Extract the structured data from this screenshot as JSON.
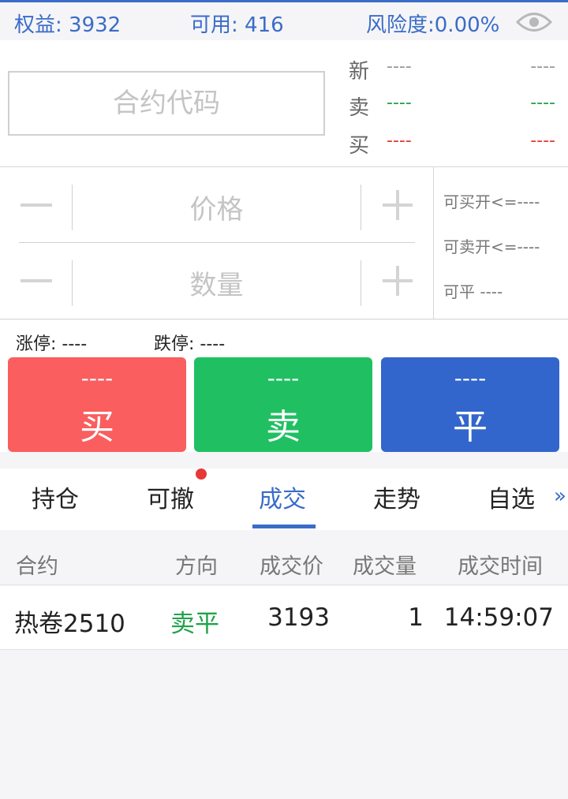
{
  "header": {
    "equity": "权益: 3932",
    "available": "可用: 416",
    "risk": "风险度:0.00%"
  },
  "quote": {
    "code_placeholder": "合约代码",
    "rows": [
      {
        "label": "新",
        "v1": "----",
        "v2": "----",
        "color": "#999999"
      },
      {
        "label": "卖",
        "v1": "----",
        "v2": "----",
        "color": "#1fa34a"
      },
      {
        "label": "买",
        "v1": "----",
        "v2": "----",
        "color": "#e53935"
      }
    ]
  },
  "entry": {
    "price_placeholder": "价格",
    "qty_placeholder": "数量",
    "can_buy_open": "可买开<=----",
    "can_sell_open": "可卖开<=----",
    "can_close": "可平  ----"
  },
  "limits": {
    "up": "涨停: ----",
    "down": "跌停: ----"
  },
  "buttons": [
    {
      "price": "----",
      "label": "买",
      "color": "#fa5e5e"
    },
    {
      "price": "----",
      "label": "卖",
      "color": "#20c062"
    },
    {
      "price": "----",
      "label": "平",
      "color": "#3366cc"
    }
  ],
  "tabs": [
    {
      "label": "持仓"
    },
    {
      "label": "可撤"
    },
    {
      "label": "成交"
    },
    {
      "label": "走势"
    },
    {
      "label": "自选"
    }
  ],
  "active_tab": "成交",
  "table": {
    "headers": [
      "合约",
      "方向",
      "成交价",
      "成交量",
      "成交时间"
    ],
    "rows": [
      {
        "contract": "热卷2510",
        "direction": "卖平",
        "price": "3193",
        "volume": "1",
        "time": "14:59:07"
      }
    ]
  },
  "colors": {
    "accent": "#3a6cc8",
    "sell_green": "#1fa34a"
  }
}
